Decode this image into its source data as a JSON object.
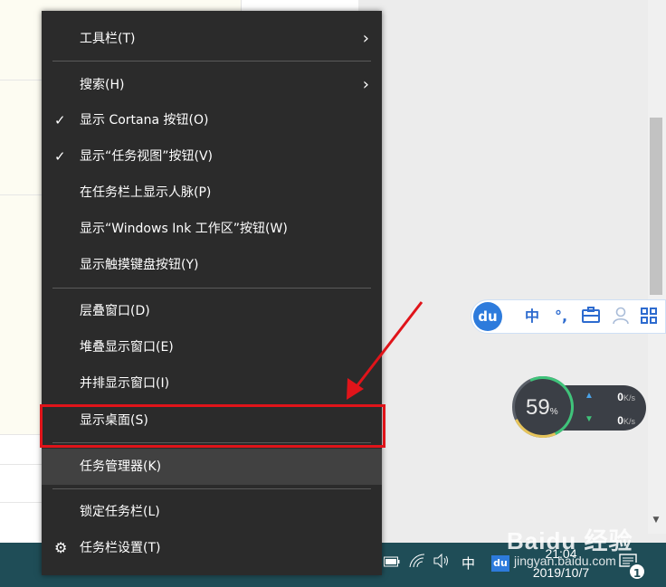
{
  "context_menu": {
    "items": [
      {
        "label": "工具栏(T)",
        "submenu": true
      },
      {
        "label": "搜索(H)",
        "submenu": true
      },
      {
        "label": "显示 Cortana 按钮(O)",
        "checked": true
      },
      {
        "label": "显示“任务视图”按钮(V)",
        "checked": true
      },
      {
        "label": "在任务栏上显示人脉(P)"
      },
      {
        "label": "显示“Windows Ink 工作区”按钮(W)"
      },
      {
        "label": "显示触摸键盘按钮(Y)"
      },
      {
        "label": "层叠窗口(D)"
      },
      {
        "label": "堆叠显示窗口(E)"
      },
      {
        "label": "并排显示窗口(I)"
      },
      {
        "label": "显示桌面(S)",
        "annotated": true
      },
      {
        "label": "任务管理器(K)",
        "highlighted": true
      },
      {
        "label": "锁定任务栏(L)"
      },
      {
        "label": "任务栏设置(T)",
        "icon": "gear-icon"
      }
    ]
  },
  "ime_toolbar": {
    "logo": "du",
    "mode_label": "中",
    "punct_label": "°,",
    "icons": [
      "toolbox-icon",
      "user-icon",
      "grid-icon"
    ]
  },
  "net_monitor": {
    "percent": "59",
    "percent_unit": "%",
    "upload_value": "0",
    "download_value": "0",
    "unit": "K/s"
  },
  "taskbar": {
    "ime_mode": "中",
    "time": "21:04",
    "date": "2019/10/7",
    "notification_count": "1"
  },
  "watermark": {
    "text": "Baidu 经验",
    "url": "jingyan.baidu.com"
  },
  "colors": {
    "menu_bg": "#2b2b2b",
    "menu_highlight": "#414141",
    "annotation_red": "#e0141a",
    "taskbar_bg": "#1f4d57",
    "ime_blue": "#2d7bdc"
  }
}
